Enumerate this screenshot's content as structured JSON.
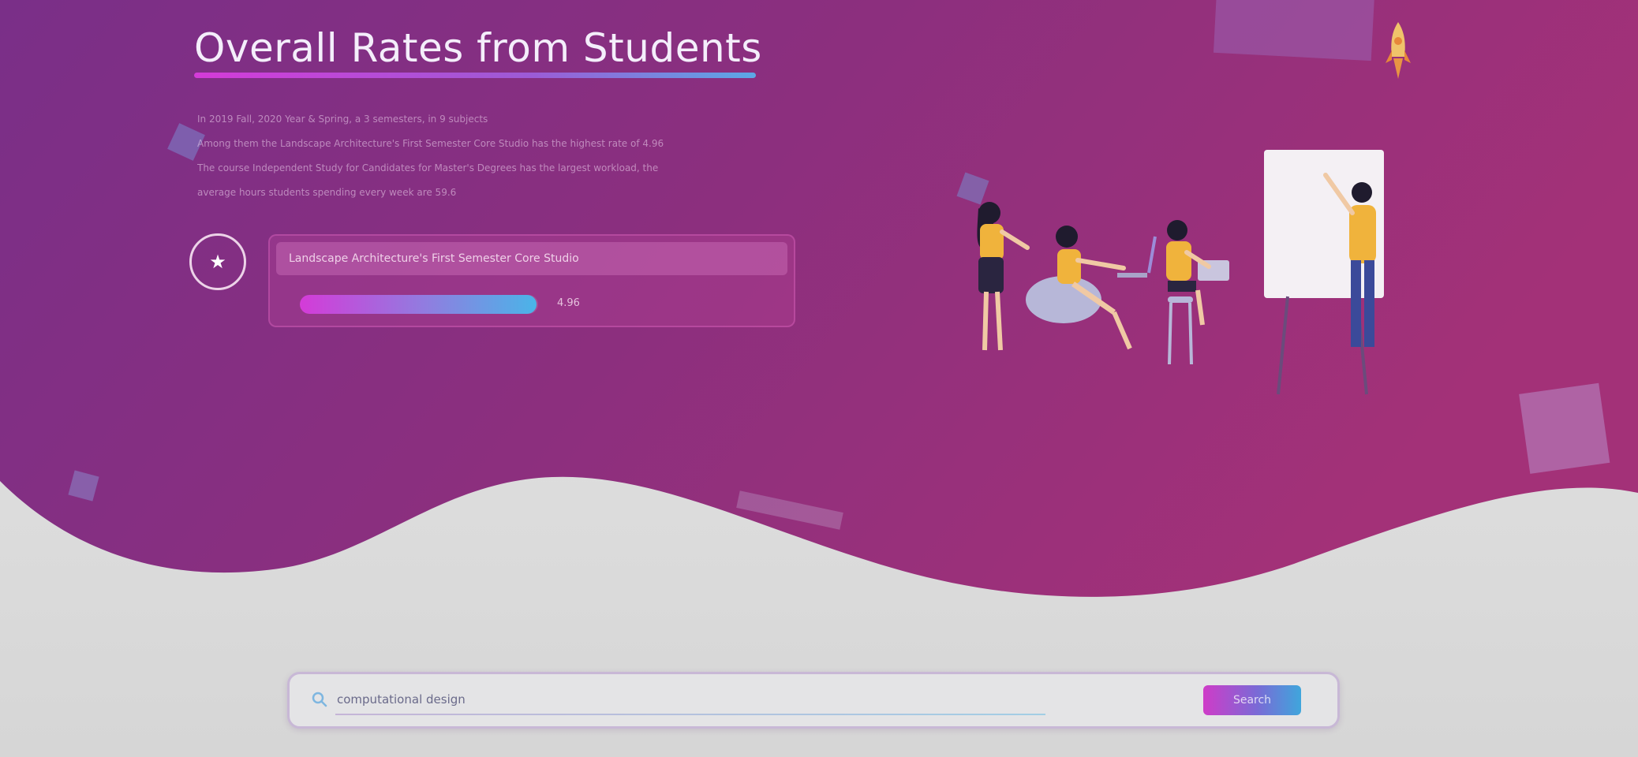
{
  "section": {
    "title": "Overall Rates from Students",
    "summary_lines": [
      "In 2019 Fall, 2020 Year & Spring, a 3 semesters, in 9 subjects",
      "Among them the Landscape Architecture's First Semester Core Studio has the highest rate of 4.96",
      "The course Independent Study for Candidates for Master's Degrees has the largest workload, the",
      "average hours students spending every week are 59.6"
    ]
  },
  "top_course": {
    "rank_icon": "star-icon",
    "name": "Landscape Architecture's First Semester Core Studio",
    "rate": 4.96,
    "rate_label": "4.96",
    "rate_max": 5
  },
  "search": {
    "value": "computational design",
    "button_label": "Search",
    "icon": "search-icon"
  },
  "colors": {
    "hero_start": "#7a2e86",
    "hero_end": "#a3307a",
    "accent_pink": "#d43bd8",
    "accent_blue": "#4ab4e8"
  }
}
